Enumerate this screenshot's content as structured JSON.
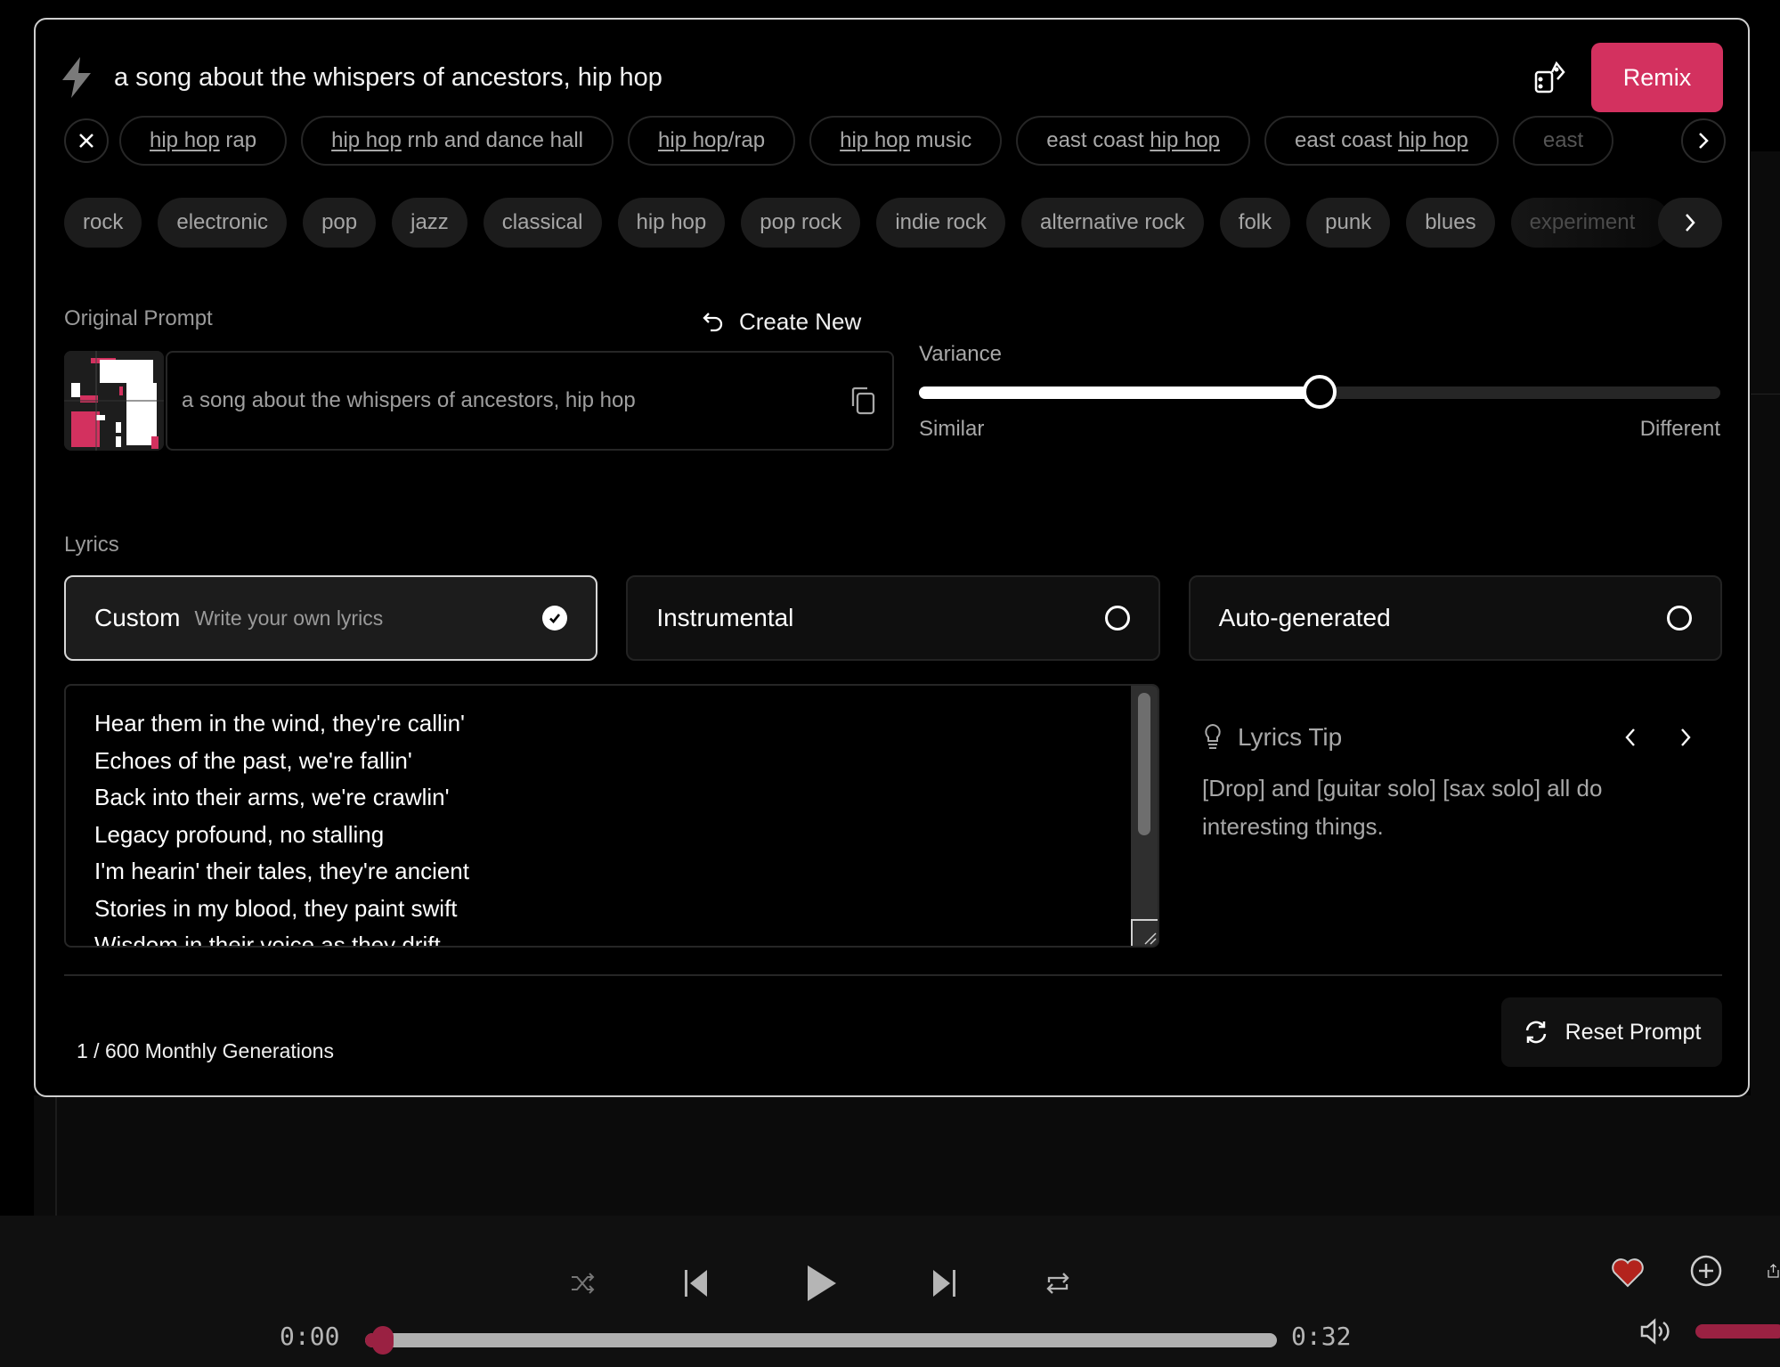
{
  "header": {
    "prompt": "a song about the whispers of ancestors, hip hop",
    "remix_label": "Remix",
    "icons": {
      "left": "lightning-bolt-icon",
      "random": "dice-icon"
    }
  },
  "suggestions": {
    "clear_icon": "close-icon",
    "next_icon": "chevron-right-icon",
    "chips": [
      {
        "pre": "",
        "highlight": "hip hop",
        "post": " rap"
      },
      {
        "pre": "",
        "highlight": "hip hop",
        "post": " rnb and dance hall"
      },
      {
        "pre": "",
        "highlight": "hip hop",
        "post": "/rap"
      },
      {
        "pre": "",
        "highlight": "hip hop",
        "post": " music"
      },
      {
        "pre": "east coast ",
        "highlight": "hip hop",
        "post": ""
      },
      {
        "pre": "east coast ",
        "highlight": "hip hop",
        "post": ""
      },
      {
        "pre": "east",
        "highlight": "",
        "post": ""
      }
    ]
  },
  "genres": {
    "items": [
      "rock",
      "electronic",
      "pop",
      "jazz",
      "classical",
      "hip hop",
      "pop rock",
      "indie rock",
      "alternative rock",
      "folk",
      "punk",
      "blues",
      "experiment"
    ],
    "next_icon": "chevron-right-icon"
  },
  "original_prompt": {
    "label": "Original Prompt",
    "create_new_label": "Create New",
    "text": "a song about the whispers of ancestors, hip hop"
  },
  "variance": {
    "label": "Variance",
    "min_label": "Similar",
    "max_label": "Different",
    "value_fraction": 0.5
  },
  "lyrics": {
    "label": "Lyrics",
    "options": [
      {
        "title": "Custom",
        "subtitle": "Write your own lyrics",
        "selected": true
      },
      {
        "title": "Instrumental",
        "subtitle": "",
        "selected": false
      },
      {
        "title": "Auto-generated",
        "subtitle": "",
        "selected": false
      }
    ],
    "text": "Hear them in the wind, they're callin'\nEchoes of the past, we're fallin'\nBack into their arms, we're crawlin'\nLegacy profound, no stalling\nI'm hearin' their tales, they're ancient\nStories in my blood, they paint swift\nWisdom in their voice as they drift"
  },
  "tip": {
    "title": "Lyrics Tip",
    "body": "[Drop] and [guitar solo] [sax solo] all do interesting things."
  },
  "footer": {
    "generations": "1 / 600 Monthly Generations",
    "reset_label": "Reset Prompt"
  },
  "player": {
    "current_time": "0:00",
    "duration": "0:32",
    "progress_fraction": 0.02,
    "liked": true,
    "colors": {
      "accent": "#d3315f",
      "progress": "#9a2142",
      "heart": "#b3231d"
    }
  }
}
